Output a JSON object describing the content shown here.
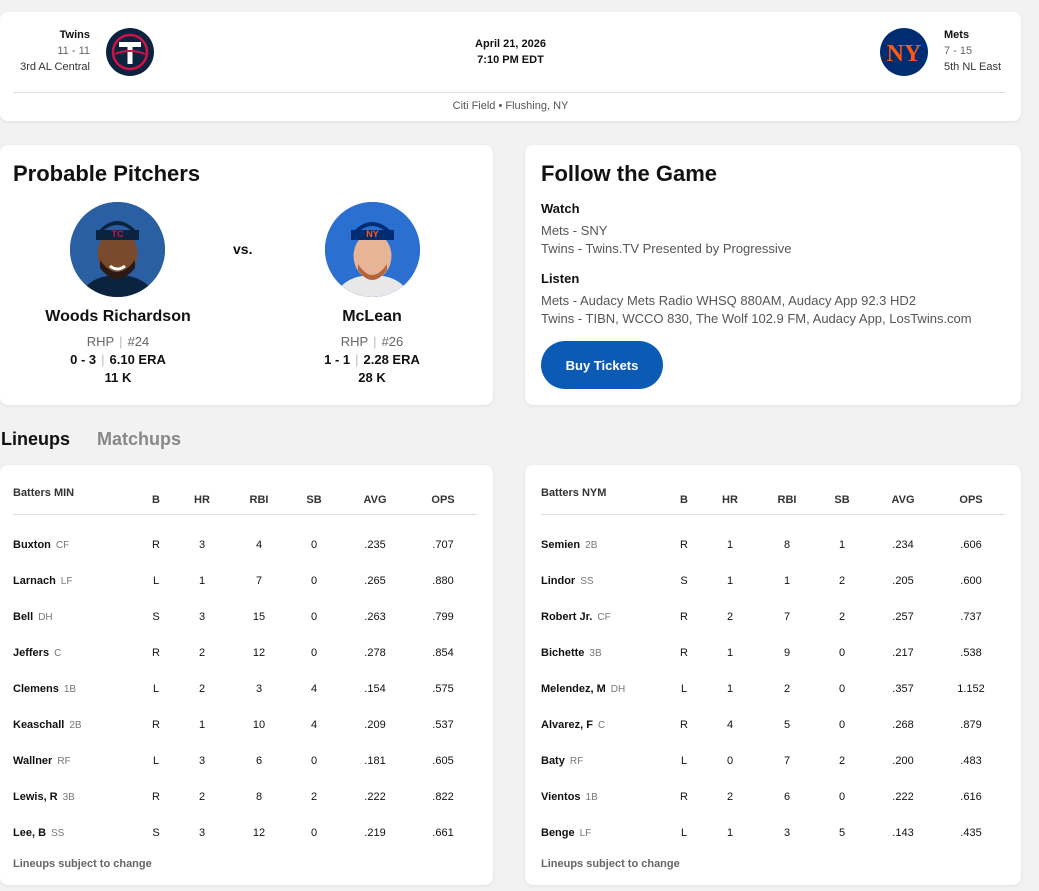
{
  "game": {
    "away": {
      "name": "Twins",
      "record": "11 - 11",
      "standing": "3rd AL Central",
      "color": "#0c2340",
      "accent": "#d31145"
    },
    "home": {
      "name": "Mets",
      "record": "7 - 15",
      "standing": "5th NL East",
      "color": "#002d72",
      "accent": "#ff5910"
    },
    "date": "April 21, 2026",
    "time": "7:10 PM EDT",
    "venue": "Citi Field • Flushing, NY"
  },
  "pitchers": {
    "title": "Probable Pitchers",
    "vs": "vs.",
    "away": {
      "name": "Woods Richardson",
      "throws": "RHP",
      "number": "#24",
      "record": "0 - 3",
      "era": "6.10 ERA",
      "k": "11 K"
    },
    "home": {
      "name": "McLean",
      "throws": "RHP",
      "number": "#26",
      "record": "1 - 1",
      "era": "2.28 ERA",
      "k": "28 K"
    }
  },
  "follow": {
    "title": "Follow the Game",
    "watch_label": "Watch",
    "watch": [
      "Mets - SNY",
      "Twins - Twins.TV Presented by Progressive"
    ],
    "listen_label": "Listen",
    "listen": [
      "Mets - Audacy Mets Radio WHSQ 880AM, Audacy App 92.3 HD2",
      "Twins - TIBN, WCCO 830, The Wolf 102.9 FM, Audacy App, LosTwins.com"
    ],
    "buy_label": "Buy Tickets",
    "accent": "#0b5bb5"
  },
  "tabs": {
    "lineups": "Lineups",
    "matchups": "Matchups"
  },
  "lineups": {
    "columns": [
      "B",
      "HR",
      "RBI",
      "SB",
      "AVG",
      "OPS"
    ],
    "footnote": "Lineups subject to change",
    "min": {
      "header": "Batters MIN",
      "rows": [
        {
          "name": "Buxton",
          "pos": "CF",
          "b": "R",
          "hr": "3",
          "rbi": "4",
          "sb": "0",
          "avg": ".235",
          "ops": ".707"
        },
        {
          "name": "Larnach",
          "pos": "LF",
          "b": "L",
          "hr": "1",
          "rbi": "7",
          "sb": "0",
          "avg": ".265",
          "ops": ".880"
        },
        {
          "name": "Bell",
          "pos": "DH",
          "b": "S",
          "hr": "3",
          "rbi": "15",
          "sb": "0",
          "avg": ".263",
          "ops": ".799"
        },
        {
          "name": "Jeffers",
          "pos": "C",
          "b": "R",
          "hr": "2",
          "rbi": "12",
          "sb": "0",
          "avg": ".278",
          "ops": ".854"
        },
        {
          "name": "Clemens",
          "pos": "1B",
          "b": "L",
          "hr": "2",
          "rbi": "3",
          "sb": "4",
          "avg": ".154",
          "ops": ".575"
        },
        {
          "name": "Keaschall",
          "pos": "2B",
          "b": "R",
          "hr": "1",
          "rbi": "10",
          "sb": "4",
          "avg": ".209",
          "ops": ".537"
        },
        {
          "name": "Wallner",
          "pos": "RF",
          "b": "L",
          "hr": "3",
          "rbi": "6",
          "sb": "0",
          "avg": ".181",
          "ops": ".605"
        },
        {
          "name": "Lewis, R",
          "pos": "3B",
          "b": "R",
          "hr": "2",
          "rbi": "8",
          "sb": "2",
          "avg": ".222",
          "ops": ".822"
        },
        {
          "name": "Lee, B",
          "pos": "SS",
          "b": "S",
          "hr": "3",
          "rbi": "12",
          "sb": "0",
          "avg": ".219",
          "ops": ".661"
        }
      ]
    },
    "nym": {
      "header": "Batters NYM",
      "rows": [
        {
          "name": "Semien",
          "pos": "2B",
          "b": "R",
          "hr": "1",
          "rbi": "8",
          "sb": "1",
          "avg": ".234",
          "ops": ".606"
        },
        {
          "name": "Lindor",
          "pos": "SS",
          "b": "S",
          "hr": "1",
          "rbi": "1",
          "sb": "2",
          "avg": ".205",
          "ops": ".600"
        },
        {
          "name": "Robert Jr.",
          "pos": "CF",
          "b": "R",
          "hr": "2",
          "rbi": "7",
          "sb": "2",
          "avg": ".257",
          "ops": ".737"
        },
        {
          "name": "Bichette",
          "pos": "3B",
          "b": "R",
          "hr": "1",
          "rbi": "9",
          "sb": "0",
          "avg": ".217",
          "ops": ".538"
        },
        {
          "name": "Melendez, M",
          "pos": "DH",
          "b": "L",
          "hr": "1",
          "rbi": "2",
          "sb": "0",
          "avg": ".357",
          "ops": "1.152"
        },
        {
          "name": "Alvarez, F",
          "pos": "C",
          "b": "R",
          "hr": "4",
          "rbi": "5",
          "sb": "0",
          "avg": ".268",
          "ops": ".879"
        },
        {
          "name": "Baty",
          "pos": "RF",
          "b": "L",
          "hr": "0",
          "rbi": "7",
          "sb": "2",
          "avg": ".200",
          "ops": ".483"
        },
        {
          "name": "Vientos",
          "pos": "1B",
          "b": "R",
          "hr": "2",
          "rbi": "6",
          "sb": "0",
          "avg": ".222",
          "ops": ".616"
        },
        {
          "name": "Benge",
          "pos": "LF",
          "b": "L",
          "hr": "1",
          "rbi": "3",
          "sb": "5",
          "avg": ".143",
          "ops": ".435"
        }
      ]
    }
  }
}
